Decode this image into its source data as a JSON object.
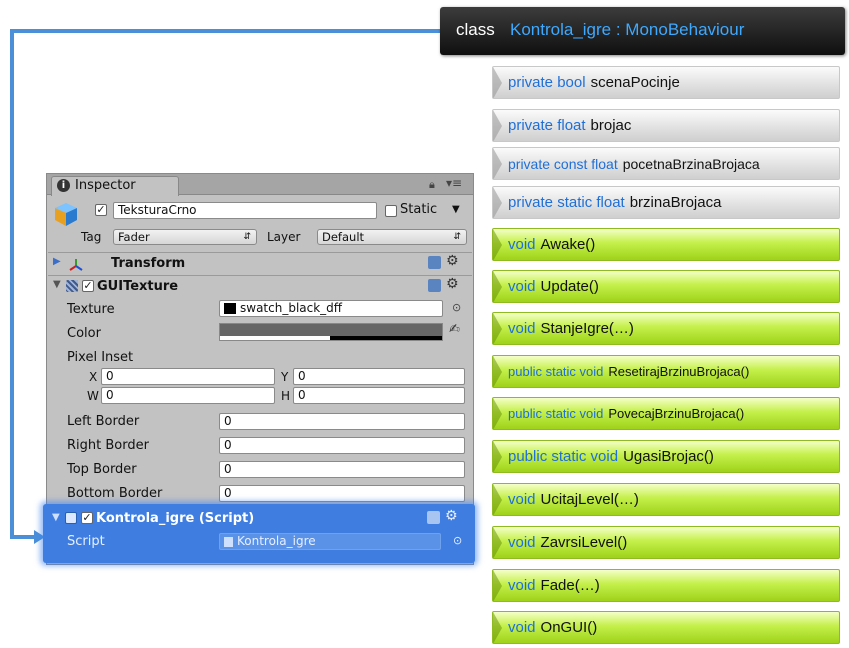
{
  "class_header": {
    "prefix": "class",
    "name": "Kontrola_igre : MonoBehaviour"
  },
  "fields": [
    {
      "keywords": "private bool",
      "name": "scenaPocinje"
    },
    {
      "keywords": "private float",
      "name": "brojac"
    },
    {
      "keywords": "private const float",
      "name": "pocetnaBrzinaBrojaca"
    },
    {
      "keywords": "private static float",
      "name": "brzinaBrojaca"
    }
  ],
  "methods": [
    {
      "keywords": "void",
      "name": "Awake()"
    },
    {
      "keywords": "void",
      "name": "Update()"
    },
    {
      "keywords": "void",
      "name": "StanjeIgre(…)"
    },
    {
      "keywords": "public static void",
      "name": "ResetirajBrzinuBrojaca()"
    },
    {
      "keywords": "public static void",
      "name": "PovecajBrzinuBrojaca()"
    },
    {
      "keywords": "public static void",
      "name": "UgasiBrojac()"
    },
    {
      "keywords": "void",
      "name": "UcitajLevel(…)"
    },
    {
      "keywords": "void",
      "name": "ZavrsiLevel()"
    },
    {
      "keywords": "void",
      "name": "Fade(…)"
    },
    {
      "keywords": "void",
      "name": "OnGUI()"
    }
  ],
  "inspector": {
    "tab": "Inspector",
    "object_name": "TeksturaCrno",
    "static_label": "Static",
    "tag_label": "Tag",
    "tag_value": "Fader",
    "layer_label": "Layer",
    "layer_value": "Default",
    "transform": "Transform",
    "gui_texture": {
      "title": "GUITexture",
      "texture_label": "Texture",
      "texture_value": "swatch_black_dff",
      "color_label": "Color",
      "pixel_inset_label": "Pixel Inset",
      "x_label": "X",
      "x": "0",
      "y_label": "Y",
      "y": "0",
      "w_label": "W",
      "w": "0",
      "h_label": "H",
      "h": "0",
      "left_border_label": "Left Border",
      "left_border": "0",
      "right_border_label": "Right Border",
      "right_border": "0",
      "top_border_label": "Top Border",
      "top_border": "0",
      "bottom_border_label": "Bottom Border",
      "bottom_border": "0"
    },
    "script_component": {
      "title": "Kontrola_igre (Script)",
      "script_label": "Script",
      "script_value": "Kontrola_igre"
    }
  },
  "colors": {
    "keyword": "#1f6fd8",
    "method_fill": "#b8e837",
    "connector": "#4a8fd8",
    "selection": "#3f7ee0"
  }
}
